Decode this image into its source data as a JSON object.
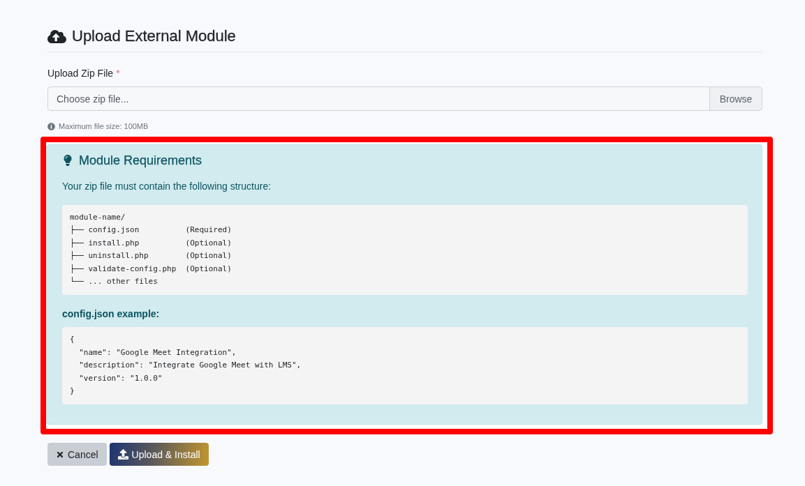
{
  "header": {
    "title": "Upload External Module"
  },
  "upload_field": {
    "label": "Upload Zip File",
    "required_mark": "*",
    "placeholder": "Choose zip file...",
    "browse_label": "Browse",
    "hint": "Maximum file size: 100MB"
  },
  "requirements": {
    "highlighted": true,
    "title": "Module Requirements",
    "intro": "Your zip file must contain the following structure:",
    "structure_lines": [
      "module-name/",
      "├── config.json          (Required)",
      "├── install.php          (Optional)",
      "├── uninstall.php        (Optional)",
      "├── validate-config.php  (Optional)",
      "└── ... other files"
    ],
    "example_title": "config.json example:",
    "example_lines": [
      "{",
      "  \"name\": \"Google Meet Integration\",",
      "  \"description\": \"Integrate Google Meet with LMS\",",
      "  \"version\": \"1.0.0\"",
      "}"
    ]
  },
  "buttons": [
    {
      "kind": "secondary",
      "label": "Cancel"
    },
    {
      "kind": "primary",
      "label": "Upload & Install"
    }
  ]
}
